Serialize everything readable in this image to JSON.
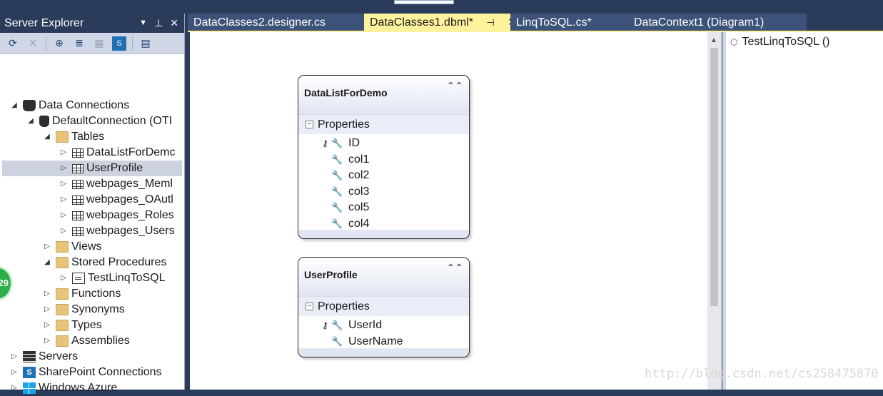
{
  "server_explorer": {
    "title": "Server Explorer",
    "controls": {
      "dropdown": "▼",
      "pin": "🖈",
      "close": "✕"
    },
    "toolbar": [
      "refresh-icon",
      "stop-icon",
      "connect-db-icon",
      "connect-server-icon",
      "sharepoint-connect-icon",
      "azure-icon",
      "properties-icon"
    ],
    "tree": [
      {
        "label": "Data Connections",
        "icon": "data-connections-icon",
        "expanded": true
      },
      {
        "label": "DefaultConnection (OTI",
        "icon": "database-icon",
        "expanded": true
      },
      {
        "label": "Tables",
        "icon": "folder-icon",
        "expanded": true
      },
      {
        "label": "DataListForDemc",
        "icon": "table-icon",
        "expanded": false
      },
      {
        "label": "UserProfile",
        "icon": "table-icon",
        "expanded": false,
        "selected": true
      },
      {
        "label": "webpages_Meml",
        "icon": "table-icon",
        "expanded": false
      },
      {
        "label": "webpages_OAutl",
        "icon": "table-icon",
        "expanded": false
      },
      {
        "label": "webpages_Roles",
        "icon": "table-icon",
        "expanded": false
      },
      {
        "label": "webpages_Users",
        "icon": "table-icon",
        "expanded": false
      },
      {
        "label": "Views",
        "icon": "folder-icon",
        "expanded": false
      },
      {
        "label": "Stored Procedures",
        "icon": "folder-icon",
        "expanded": true
      },
      {
        "label": "TestLinqToSQL",
        "icon": "stored-procedure-icon",
        "expanded": false
      },
      {
        "label": "Functions",
        "icon": "folder-icon",
        "expanded": false
      },
      {
        "label": "Synonyms",
        "icon": "folder-icon",
        "expanded": false
      },
      {
        "label": "Types",
        "icon": "folder-icon",
        "expanded": false
      },
      {
        "label": "Assemblies",
        "icon": "folder-icon",
        "expanded": false
      },
      {
        "label": "Servers",
        "icon": "servers-icon",
        "expanded": false
      },
      {
        "label": "SharePoint Connections",
        "icon": "sharepoint-icon",
        "expanded": false
      },
      {
        "label": "Windows Azure",
        "icon": "windows-azure-icon",
        "expanded": false
      }
    ]
  },
  "badge": {
    "text": "29"
  },
  "tabs": [
    {
      "label": "DataClasses2.designer.cs",
      "active": false
    },
    {
      "label": "DataClasses1.dbml*",
      "active": true
    },
    {
      "label": "LinqToSQL.cs*",
      "active": false
    },
    {
      "label": "DataContext1 (Diagram1)",
      "active": false
    }
  ],
  "tab_controls": {
    "pin": "⊣",
    "close": "✕"
  },
  "designer": {
    "entities": [
      {
        "name": "DataListForDemo",
        "section": "Properties",
        "properties": [
          {
            "name": "ID",
            "primary_key": true
          },
          {
            "name": "col1",
            "primary_key": false
          },
          {
            "name": "col2",
            "primary_key": false
          },
          {
            "name": "col3",
            "primary_key": false
          },
          {
            "name": "col5",
            "primary_key": false
          },
          {
            "name": "col4",
            "primary_key": false
          }
        ]
      },
      {
        "name": "UserProfile",
        "section": "Properties",
        "properties": [
          {
            "name": "UserId",
            "primary_key": true
          },
          {
            "name": "UserName",
            "primary_key": false
          }
        ]
      }
    ]
  },
  "methods_pane": {
    "items": [
      {
        "label": "TestLinqToSQL ()",
        "icon": "method-icon"
      }
    ]
  },
  "watermark": "http://blog.csdn.net/cs258475870",
  "colors": {
    "chrome_dark": "#2b3b5a",
    "tab_inactive": "#3d5279",
    "tab_active": "#fff29d",
    "selection": "#ccd3de",
    "entity_header": "#dfe5f3"
  }
}
